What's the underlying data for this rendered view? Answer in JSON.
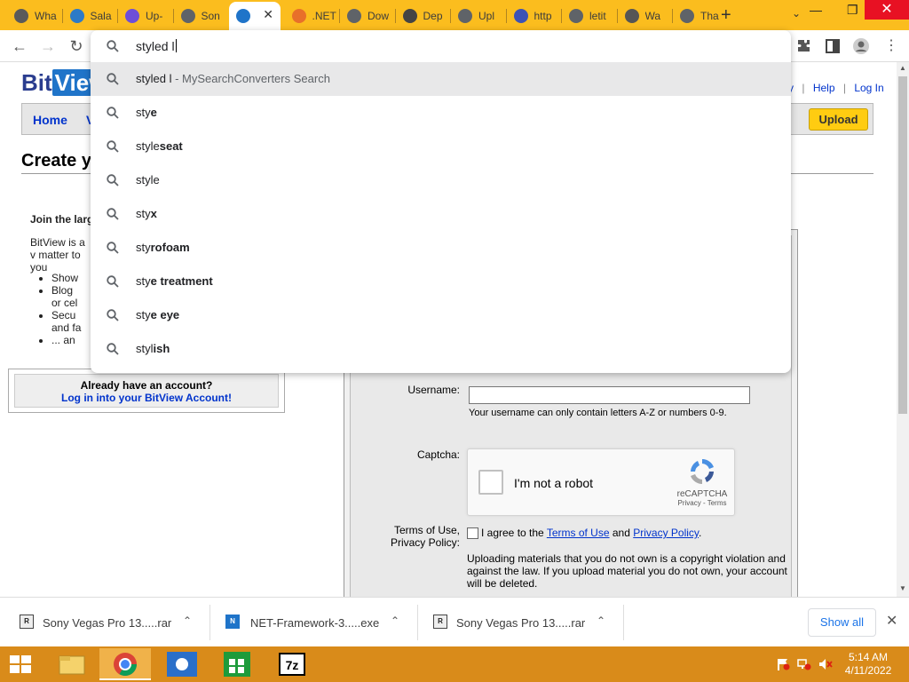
{
  "browser": {
    "tabs": [
      {
        "title": "Wha",
        "favicon": "g-icon",
        "color": "#5a5a5a"
      },
      {
        "title": "Sala",
        "favicon": "fish-icon",
        "color": "#2d7ac7"
      },
      {
        "title": "Up-",
        "favicon": "u-icon",
        "color": "#6d4ed8"
      },
      {
        "title": "Son",
        "favicon": "globe-icon",
        "color": "#5f6368"
      },
      {
        "title": "",
        "favicon": "bitview-icon",
        "color": "#1f74c9"
      },
      {
        "title": ".NET",
        "favicon": "dotnet-icon",
        "color": "#e8702a"
      },
      {
        "title": "Dow",
        "favicon": "globe-icon",
        "color": "#5f6368"
      },
      {
        "title": "Dep",
        "favicon": "dep-icon",
        "color": "#444"
      },
      {
        "title": "Upl",
        "favicon": "globe-icon",
        "color": "#5f6368"
      },
      {
        "title": "http",
        "favicon": "card-icon",
        "color": "#3d52b5"
      },
      {
        "title": "letit",
        "favicon": "globe-icon",
        "color": "#5f6368"
      },
      {
        "title": "Wa",
        "favicon": "star-icon",
        "color": "#555"
      },
      {
        "title": "Tha",
        "favicon": "globe-icon",
        "color": "#5f6368"
      }
    ],
    "omnibox": {
      "value": "styled l",
      "suggestions": [
        {
          "prefix": "styled l",
          "bold": "",
          "desc": " - MySearchConverters Search",
          "selected": true
        },
        {
          "prefix": "sty",
          "bold": "e"
        },
        {
          "prefix": "style",
          "bold": "seat"
        },
        {
          "prefix": "style",
          "bold": ""
        },
        {
          "prefix": "sty",
          "bold": "x"
        },
        {
          "prefix": "sty",
          "bold": "rofoam"
        },
        {
          "prefix": "sty",
          "bold": "e treatment"
        },
        {
          "prefix": "sty",
          "bold": "e eye"
        },
        {
          "prefix": "styl",
          "bold": "ish"
        }
      ]
    }
  },
  "site": {
    "logo_bit": "Bit",
    "logo_view": "View",
    "toplinks": [
      "ry",
      "Help",
      "Log In"
    ],
    "nav_home": "Home",
    "nav_v": "V",
    "upload": "Upload",
    "heading": "Create y",
    "join": "Join the larg",
    "intro": "BitView is a v matter to you",
    "bullets": [
      "Show",
      "Blog",
      "or cel",
      "Secu",
      "and fa",
      "... an"
    ],
    "already_q": "Already have an account?",
    "already_link": "Log in into your BitView Account!",
    "form": {
      "username_label": "Username:",
      "username_hint": "Your username can only contain letters A-Z or numbers 0-9.",
      "captcha_label": "Captcha:",
      "captcha_text": "I'm not a robot",
      "captcha_brand": "reCAPTCHA",
      "captcha_terms": "Privacy - Terms",
      "terms_label_1": "Terms of Use,",
      "terms_label_2": "Privacy Policy:",
      "agree_pre": "I agree to the",
      "agree_terms": "Terms of Use",
      "agree_and": "and",
      "agree_privacy": "Privacy Policy",
      "agree_end": ".",
      "warning": "Uploading materials that you do not own is a copyright violation and against the law. If you upload material you do not own, your account will be deleted."
    }
  },
  "downloads": {
    "items": [
      "Sony Vegas Pro 13.....rar",
      "NET-Framework-3.....exe",
      "Sony Vegas Pro 13.....rar"
    ],
    "show_all": "Show all"
  },
  "taskbar": {
    "time": "5:14 AM",
    "date": "4/11/2022"
  }
}
